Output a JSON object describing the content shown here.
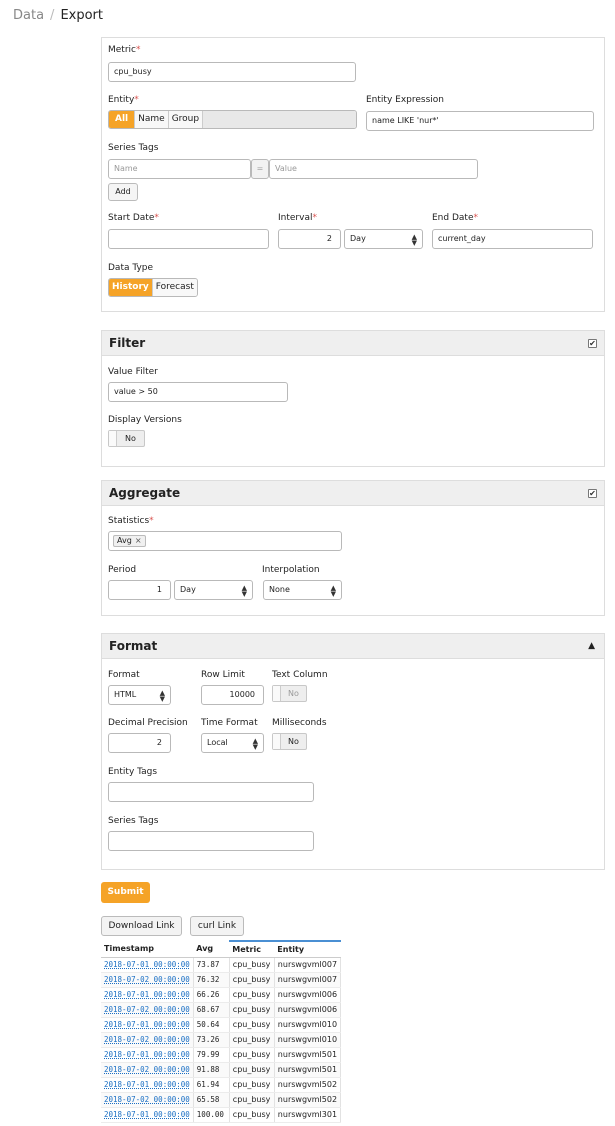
{
  "breadcrumb": {
    "parent": "Data",
    "current": "Export"
  },
  "query": {
    "metric_label": "Metric",
    "metric_value": "cpu_busy",
    "entity_label": "Entity",
    "entity_options": [
      "All",
      "Name",
      "Group"
    ],
    "entity_selected": "All",
    "entity_expression_label": "Entity Expression",
    "entity_expression_value": "name LIKE 'nur*'",
    "series_tags_label": "Series Tags",
    "tag_name_placeholder": "Name",
    "tag_equals": "=",
    "tag_value_placeholder": "Value",
    "add_label": "Add",
    "start_date_label": "Start Date",
    "start_date_value": "",
    "interval_label": "Interval",
    "interval_count": "2",
    "interval_unit": "Day",
    "end_date_label": "End Date",
    "end_date_value": "current_day",
    "data_type_label": "Data Type",
    "data_type_options": [
      "History",
      "Forecast"
    ],
    "data_type_selected": "History",
    "required_mark": "*"
  },
  "filter": {
    "title": "Filter",
    "value_filter_label": "Value Filter",
    "value_filter_value": "value > 50",
    "display_versions_label": "Display Versions",
    "display_versions_value": "No",
    "checkbox_mark": "✔"
  },
  "aggregate": {
    "title": "Aggregate",
    "statistics_label": "Statistics",
    "statistics_tag": "Avg",
    "statistics_remove": "×",
    "period_label": "Period",
    "period_count": "1",
    "period_unit": "Day",
    "interpolation_label": "Interpolation",
    "interpolation_value": "None",
    "checkbox_mark": "✔"
  },
  "format": {
    "title": "Format",
    "collapse_icon": "▲",
    "format_label": "Format",
    "format_value": "HTML",
    "row_limit_label": "Row Limit",
    "row_limit_value": "10000",
    "text_column_label": "Text Column",
    "text_column_value": "No",
    "decimal_label": "Decimal Precision",
    "decimal_value": "2",
    "time_format_label": "Time Format",
    "time_format_value": "Local",
    "milliseconds_label": "Milliseconds",
    "milliseconds_value": "No",
    "entity_tags_label": "Entity Tags",
    "entity_tags_value": "",
    "series_tags_label": "Series Tags",
    "series_tags_value": ""
  },
  "actions": {
    "submit_label": "Submit",
    "download_label": "Download Link",
    "curl_label": "curl Link"
  },
  "results": {
    "columns": [
      "Timestamp",
      "Avg",
      "Metric",
      "Entity"
    ],
    "rows": [
      [
        "2018-07-01 00:00:00",
        "73.87",
        "cpu_busy",
        "nurswgvml007"
      ],
      [
        "2018-07-02 00:00:00",
        "76.32",
        "cpu_busy",
        "nurswgvml007"
      ],
      [
        "2018-07-01 00:00:00",
        "66.26",
        "cpu_busy",
        "nurswgvml006"
      ],
      [
        "2018-07-02 00:00:00",
        "68.67",
        "cpu_busy",
        "nurswgvml006"
      ],
      [
        "2018-07-01 00:00:00",
        "50.64",
        "cpu_busy",
        "nurswgvml010"
      ],
      [
        "2018-07-02 00:00:00",
        "73.26",
        "cpu_busy",
        "nurswgvml010"
      ],
      [
        "2018-07-01 00:00:00",
        "79.99",
        "cpu_busy",
        "nurswgvml501"
      ],
      [
        "2018-07-02 00:00:00",
        "91.88",
        "cpu_busy",
        "nurswgvml501"
      ],
      [
        "2018-07-01 00:00:00",
        "61.94",
        "cpu_busy",
        "nurswgvml502"
      ],
      [
        "2018-07-02 00:00:00",
        "65.58",
        "cpu_busy",
        "nurswgvml502"
      ],
      [
        "2018-07-01 00:00:00",
        "100.00",
        "cpu_busy",
        "nurswgvml301"
      ]
    ]
  }
}
